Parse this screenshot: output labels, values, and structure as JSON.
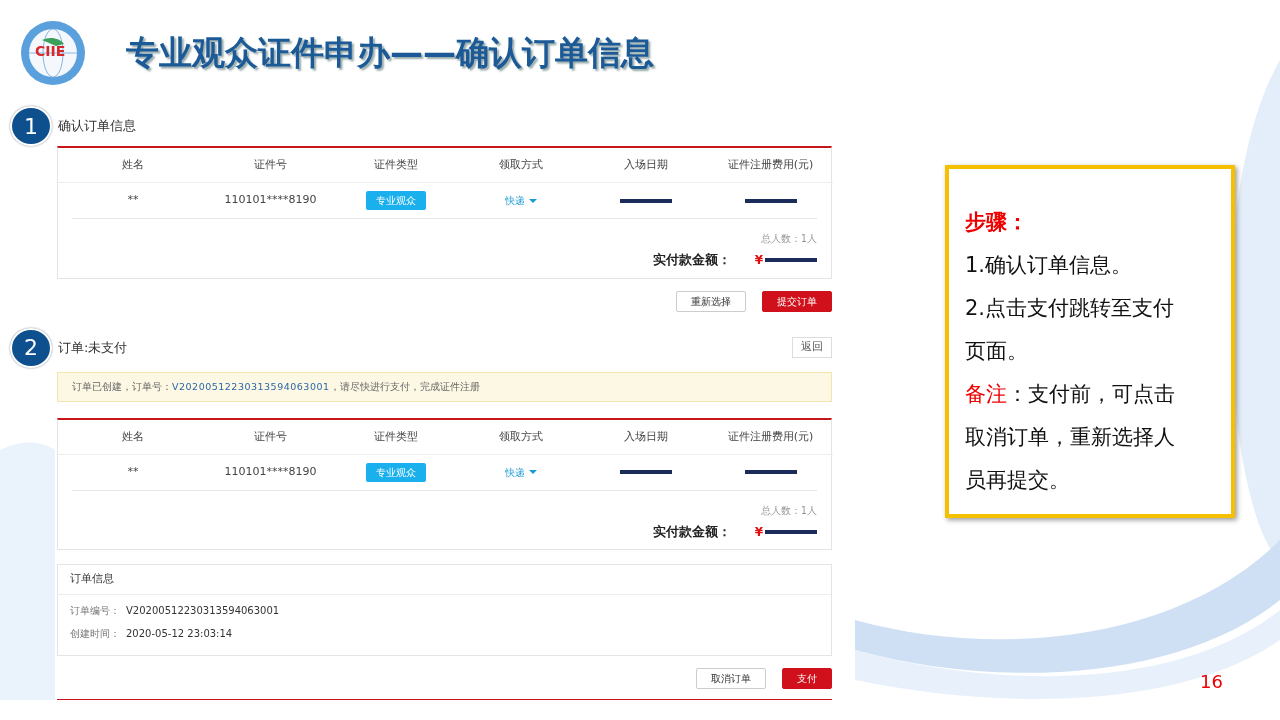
{
  "slide": {
    "title": "专业观众证件申办——确认订单信息",
    "logo_text": "CIIE",
    "page_number": "16"
  },
  "section_1": {
    "badge": "1",
    "heading": "确认订单信息",
    "order_table": {
      "columns": [
        "姓名",
        "证件号",
        "证件类型",
        "领取方式",
        "入场日期",
        "证件注册费用(元)"
      ],
      "rows": [
        {
          "name": "**",
          "id_number": "110101****8190",
          "type": "专业观众",
          "pickup": "快递",
          "date_redacted": true,
          "fee_redacted": true
        }
      ],
      "total_people": "总人数：1人",
      "amount_label": "实付款金额：",
      "currency": "¥",
      "amount_redacted": true
    },
    "buttons": [
      {
        "label": "重新选择",
        "kind": "secondary"
      },
      {
        "label": "提交订单",
        "kind": "primary"
      }
    ]
  },
  "section_2": {
    "badge": "2",
    "heading": "订单:未支付",
    "back_button": "返回",
    "alert": {
      "prefix": "订单已创建，订单号：",
      "order_number": "V20200512230313594063001",
      "suffix": "，请尽快进行支付，完成证件注册"
    },
    "order_table": {
      "columns": [
        "姓名",
        "证件号",
        "证件类型",
        "领取方式",
        "入场日期",
        "证件注册费用(元)"
      ],
      "rows": [
        {
          "name": "**",
          "id_number": "110101****8190",
          "type": "专业观众",
          "pickup": "快递",
          "date_redacted": true,
          "fee_redacted": true
        }
      ],
      "total_people": "总人数：1人",
      "amount_label": "实付款金额：",
      "currency": "¥",
      "amount_redacted": true
    },
    "order_info": {
      "title": "订单信息",
      "fields": [
        {
          "label": "订单编号：",
          "value": "V20200512230313594063001"
        },
        {
          "label": "创建时间：",
          "value": "2020-05-12 23:03:14"
        }
      ]
    },
    "buttons": [
      {
        "label": "取消订单",
        "kind": "secondary"
      },
      {
        "label": "支付",
        "kind": "primary"
      }
    ]
  },
  "note_box": {
    "lines": [
      {
        "kind": "heading",
        "text": "步骤："
      },
      {
        "kind": "step",
        "text": "1.确认订单信息。"
      },
      {
        "kind": "step",
        "text": "2.点击支付跳转至支付页面。"
      },
      {
        "kind": "note",
        "label": "备注",
        "text": "：支付前，可点击取消订单，重新选择人员再提交。"
      }
    ]
  }
}
